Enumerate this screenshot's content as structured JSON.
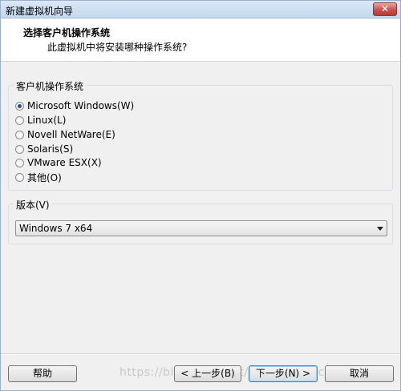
{
  "window": {
    "title": "新建虚拟机向导",
    "close_glyph": "✕"
  },
  "header": {
    "title": "选择客户机操作系统",
    "subtitle": "此虚拟机中将安装哪种操作系统?"
  },
  "os_group": {
    "legend": "客户机操作系统",
    "options": [
      {
        "label": "Microsoft Windows(W)",
        "checked": true
      },
      {
        "label": "Linux(L)",
        "checked": false
      },
      {
        "label": "Novell NetWare(E)",
        "checked": false
      },
      {
        "label": "Solaris(S)",
        "checked": false
      },
      {
        "label": "VMware ESX(X)",
        "checked": false
      },
      {
        "label": "其他(O)",
        "checked": false
      }
    ]
  },
  "version_group": {
    "legend": "版本(V)",
    "selected": "Windows 7 x64"
  },
  "buttons": {
    "help": "帮助",
    "back": "< 上一步(B)",
    "next": "下一步(N) >",
    "cancel": "取消"
  },
  "watermark": "https://blog.csdn.net/qq_jiaiwspace"
}
